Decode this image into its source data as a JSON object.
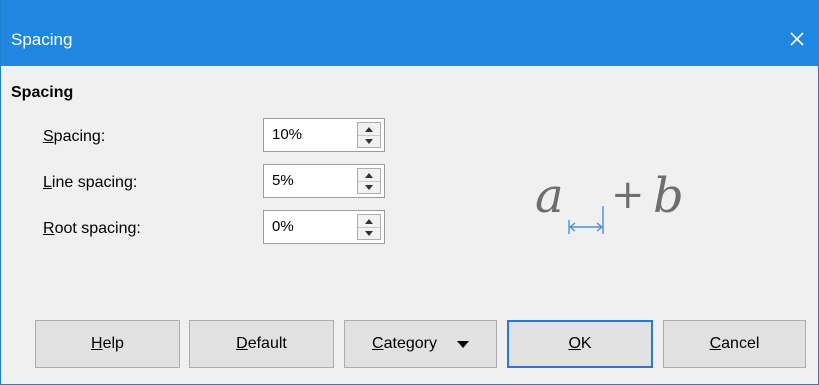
{
  "window": {
    "title": "Spacing",
    "close_icon": "close-icon"
  },
  "section": {
    "title": "Spacing"
  },
  "fields": [
    {
      "label_mnemonic": "S",
      "label_rest": "pacing:",
      "value": "10%"
    },
    {
      "label_mnemonic": "L",
      "label_rest": "ine spacing:",
      "value": "5%"
    },
    {
      "label_mnemonic": "R",
      "label_rest": "oot spacing:",
      "value": "0%"
    }
  ],
  "preview": {
    "left_symbol": "a",
    "operator": "+",
    "right_symbol": "b",
    "arrow_color": "#4a8fd6"
  },
  "buttons": {
    "help": {
      "mnemonic": "H",
      "rest": "elp"
    },
    "default": {
      "mnemonic": "D",
      "rest": "efault"
    },
    "category": {
      "mnemonic": "C",
      "rest": "ategory"
    },
    "ok": {
      "mnemonic": "O",
      "rest": "K"
    },
    "cancel": {
      "mnemonic": "C",
      "rest": "ancel"
    }
  },
  "colors": {
    "titlebar": "#1f87e0",
    "default_button_border": "#2b78d4"
  }
}
